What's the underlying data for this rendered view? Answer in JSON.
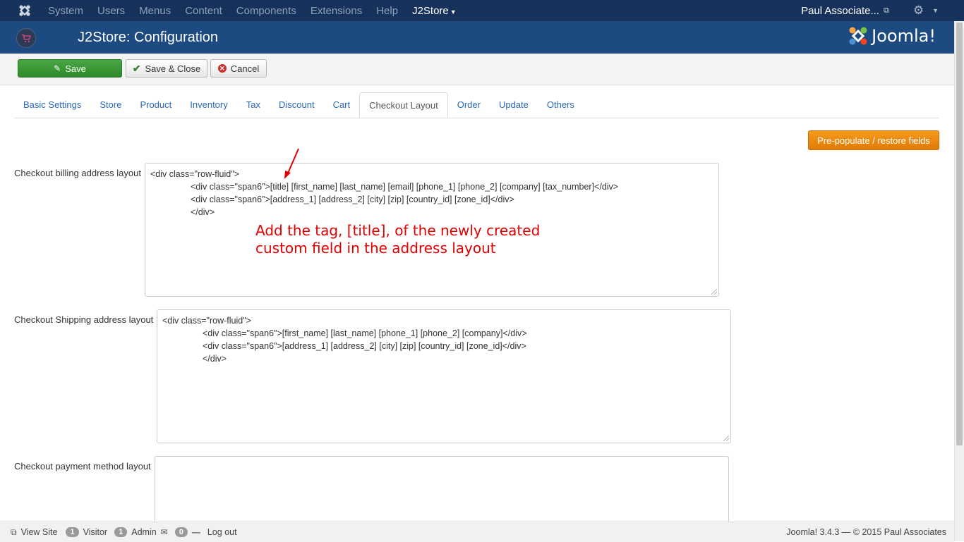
{
  "navbar": {
    "menu": [
      "System",
      "Users",
      "Menus",
      "Content",
      "Components",
      "Extensions",
      "Help",
      "J2Store"
    ],
    "user": "Paul Associate...",
    "logo_icon": "joomla-icon"
  },
  "header": {
    "title": "J2Store: Configuration",
    "brand": "Joomla!"
  },
  "toolbar": {
    "save": "Save",
    "save_close": "Save & Close",
    "cancel": "Cancel"
  },
  "tabs": [
    "Basic Settings",
    "Store",
    "Product",
    "Inventory",
    "Tax",
    "Discount",
    "Cart",
    "Checkout Layout",
    "Order",
    "Update",
    "Others"
  ],
  "active_tab": "Checkout Layout",
  "prepopulate_label": "Pre-populate / restore fields",
  "fields": {
    "billing": {
      "label": "Checkout billing address layout",
      "lines": [
        "<div class=\"row-fluid\">",
        "<div class=\"span6\">[title] [first_name] [last_name] [email] [phone_1] [phone_2] [company] [tax_number]</div>",
        "<div class=\"span6\">[address_1] [address_2] [city] [zip] [country_id] [zone_id]</div>",
        "</div>"
      ]
    },
    "shipping": {
      "label": "Checkout Shipping address layout",
      "lines": [
        "<div class=\"row-fluid\">",
        "<div class=\"span6\">[first_name] [last_name] [phone_1] [phone_2] [company]</div>",
        "<div class=\"span6\">[address_1] [address_2] [city] [zip] [country_id] [zone_id]</div>",
        "</div>"
      ]
    },
    "payment": {
      "label": "Checkout payment method layout"
    }
  },
  "annotation": {
    "line1": "Add the tag, [title], of the newly created",
    "line2": "custom field in the address layout",
    "color": "#e00000"
  },
  "statusbar": {
    "view_site": "View Site",
    "visitor_count": "1",
    "visitor_label": "Visitor",
    "admin_count": "1",
    "admin_label": "Admin",
    "messages_count": "0",
    "logout": "Log out",
    "version": "Joomla! 3.4.3  —  © 2015 Paul Associates"
  }
}
